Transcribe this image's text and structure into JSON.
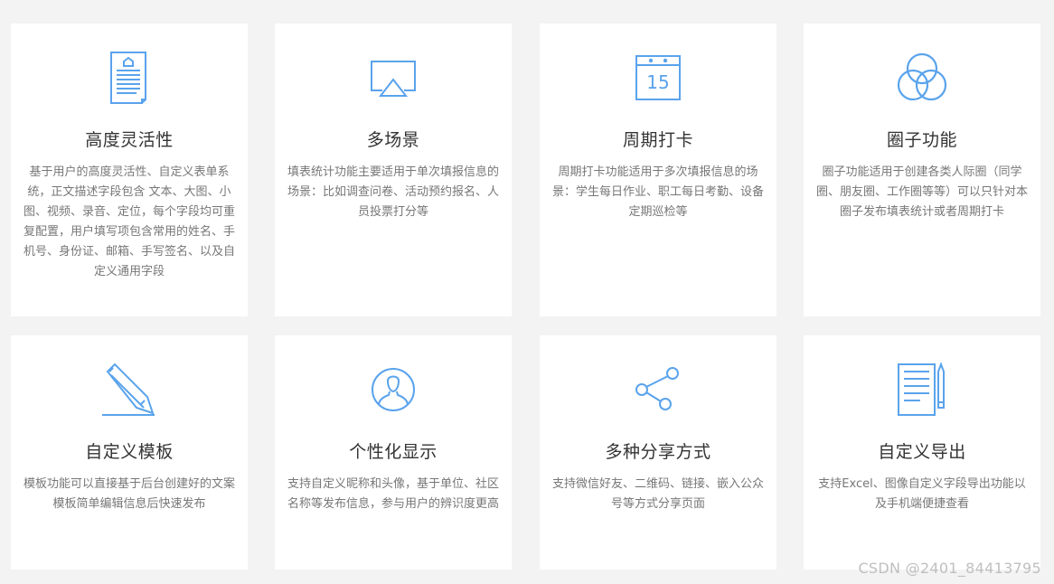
{
  "theme": {
    "icon_color": "#5aa3ec",
    "background": "#f3f3f3",
    "card_background": "#ffffff"
  },
  "features": [
    {
      "icon": "document-icon",
      "title": "高度灵活性",
      "desc": "基于用户的高度灵活性、自定义表单系统，正文描述字段包含 文本、大图、小图、视频、录音、定位，每个字段均可重复配置，用户填写项包含常用的姓名、手机号、身份证、邮箱、手写签名、以及自定义通用字段"
    },
    {
      "icon": "airplay-icon",
      "title": "多场景",
      "desc": "填表统计功能主要适用于单次填报信息的场景：比如调查问卷、活动预约报名、人员投票打分等"
    },
    {
      "icon": "calendar-icon",
      "calendar_day": "15",
      "title": "周期打卡",
      "desc": "周期打卡功能适用于多次填报信息的场景：学生每日作业、职工每日考勤、设备定期巡检等"
    },
    {
      "icon": "circles-icon",
      "title": "圈子功能",
      "desc": "圈子功能适用于创建各类人际圈（同学圈、朋友圈、工作圈等等）可以只针对本圈子发布填表统计或者周期打卡"
    },
    {
      "icon": "pencil-icon",
      "title": "自定义模板",
      "desc": "模板功能可以直接基于后台创建好的文案模板简单编辑信息后快速发布"
    },
    {
      "icon": "user-avatar-icon",
      "title": "个性化显示",
      "desc": "支持自定义昵称和头像，基于单位、社区名称等发布信息，参与用户的辨识度更高"
    },
    {
      "icon": "share-icon",
      "title": "多种分享方式",
      "desc": "支持微信好友、二维码、链接、嵌入公众号等方式分享页面"
    },
    {
      "icon": "notepad-pen-icon",
      "title": "自定义导出",
      "desc": "支持Excel、图像自定义字段导出功能以及手机端便捷查看"
    }
  ],
  "watermark": "CSDN @2401_84413795"
}
